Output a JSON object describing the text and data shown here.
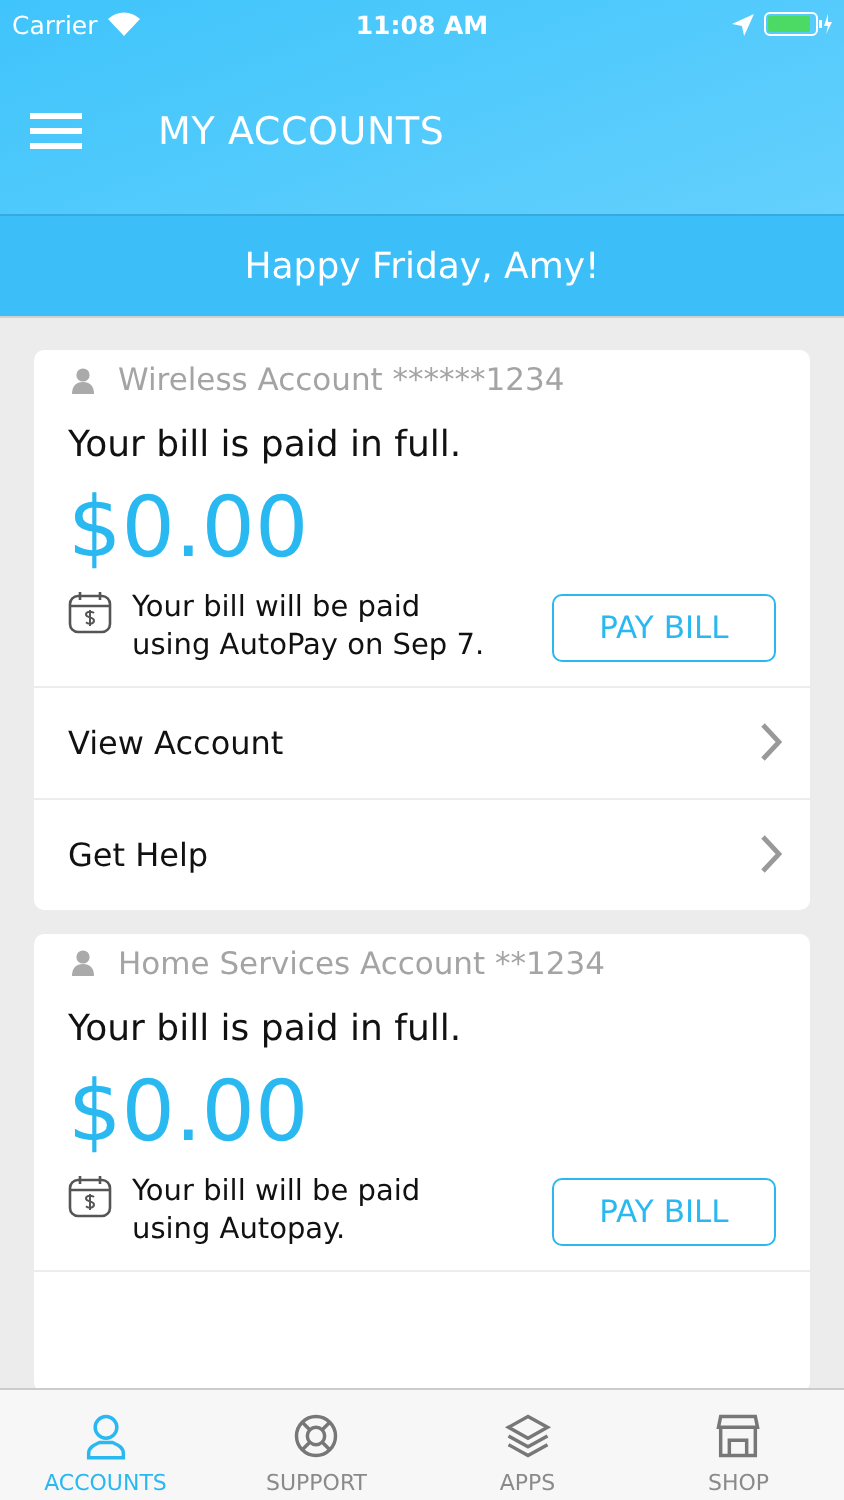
{
  "status_bar": {
    "carrier": "Carrier",
    "time": "11:08 AM"
  },
  "header": {
    "title": "MY ACCOUNTS"
  },
  "greeting": "Happy Friday, Amy!",
  "accounts": [
    {
      "name": "Wireless Account ******1234",
      "status": "Your bill is paid in full.",
      "balance": "$0.00",
      "autopay_note": "Your bill will be paid using AutoPay on Sep 7.",
      "button": "PAY BILL",
      "links": [
        "View Account",
        "Get Help"
      ]
    },
    {
      "name": "Home Services Account **1234",
      "status": "Your bill is paid in full.",
      "balance": "$0.00",
      "autopay_note": "Your bill will be paid using Autopay.",
      "button": "PAY BILL"
    }
  ],
  "tab_bar": [
    {
      "label": "ACCOUNTS",
      "kind": "person",
      "selected": true
    },
    {
      "label": "SUPPORT",
      "kind": "lifebuoy",
      "selected": false
    },
    {
      "label": "APPS",
      "kind": "layers",
      "selected": false
    },
    {
      "label": "SHOP",
      "kind": "store",
      "selected": false
    }
  ]
}
